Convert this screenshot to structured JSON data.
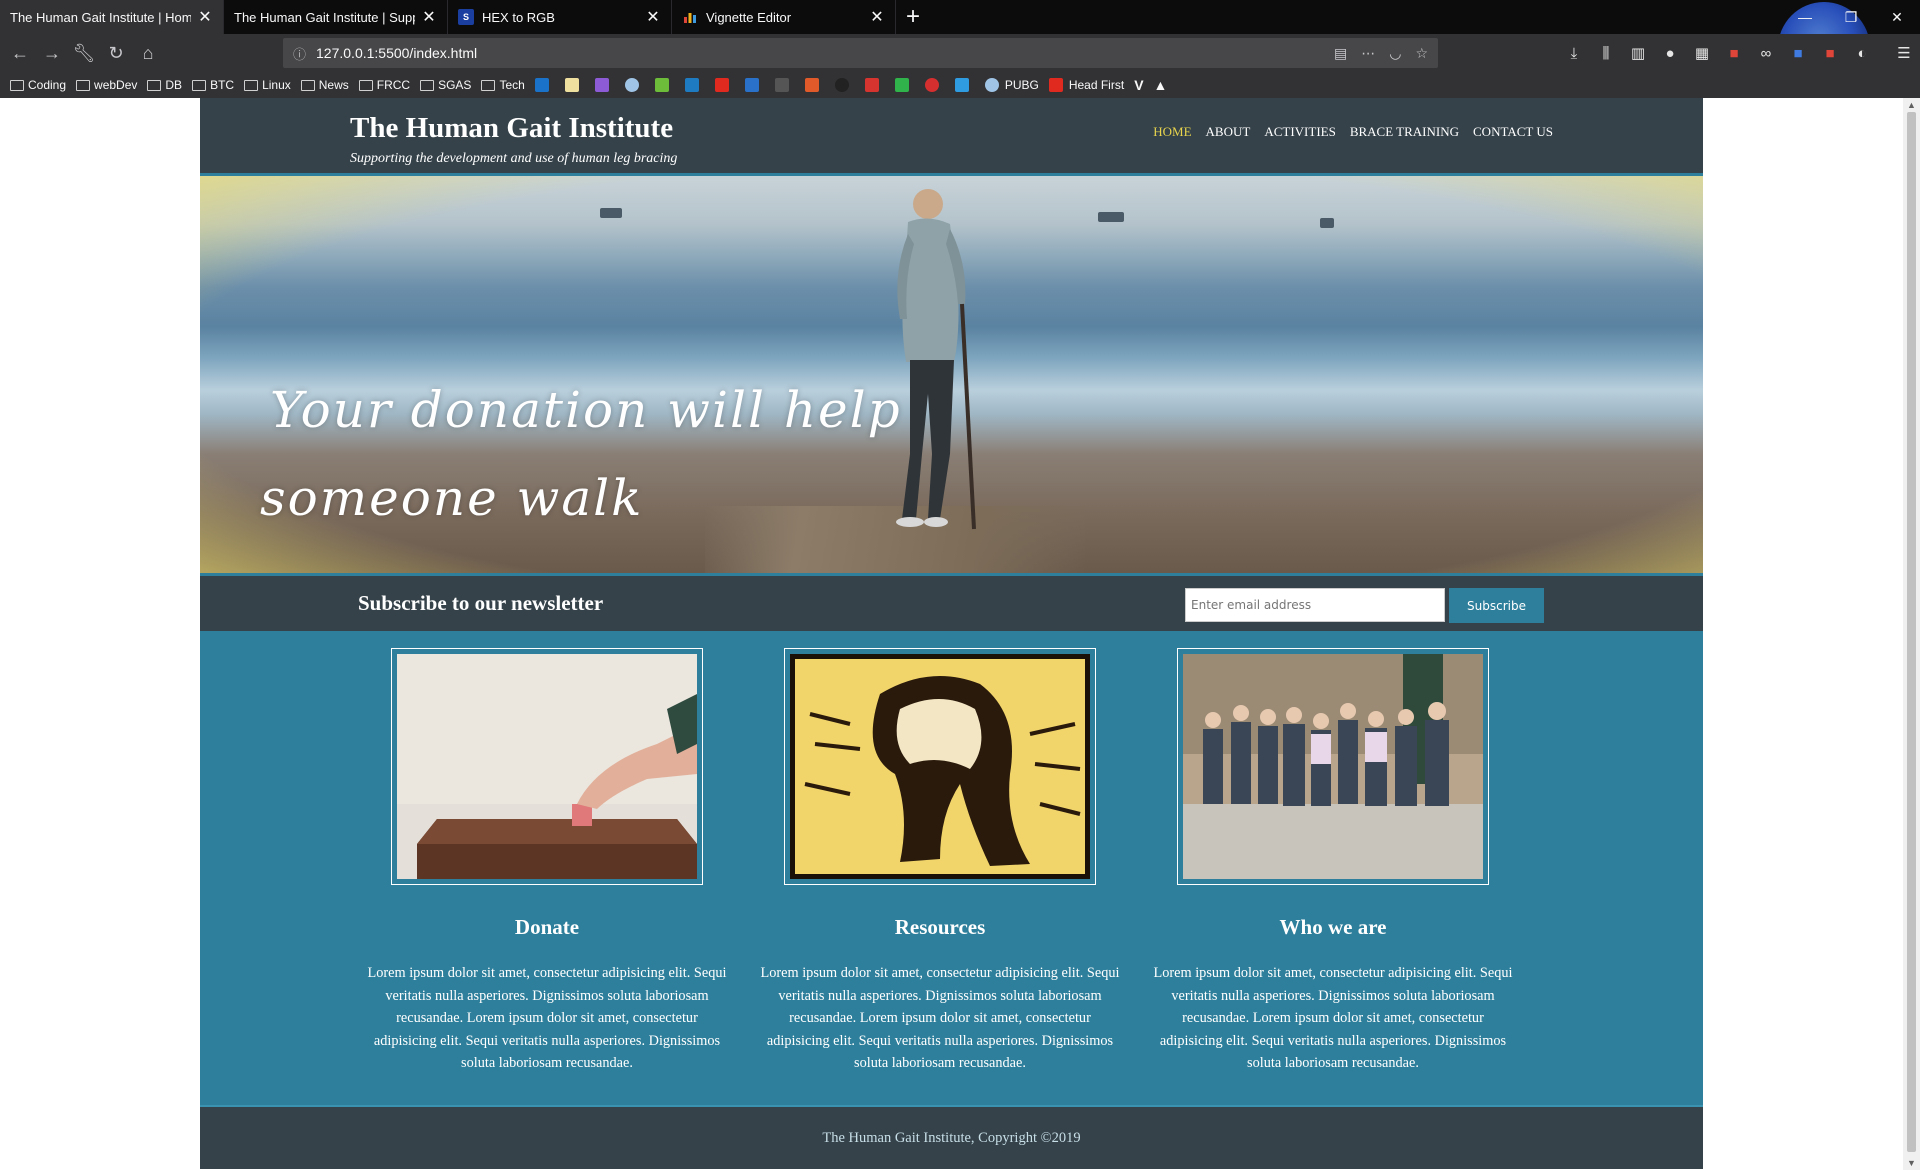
{
  "browser": {
    "tabs": [
      {
        "title": "The Human Gait Institute | Home",
        "active": true,
        "favicon": "none"
      },
      {
        "title": "The Human Gait Institute | Support",
        "active": false,
        "favicon": "none"
      },
      {
        "title": "HEX to RGB",
        "active": false,
        "favicon": "sans-tools-icon"
      },
      {
        "title": "Vignette Editor",
        "active": false,
        "favicon": "bar-chart-icon"
      }
    ],
    "url": "127.0.0.1:5500/index.html",
    "bookmarks": [
      "Coding",
      "webDev",
      "DB",
      "BTC",
      "Linux",
      "News",
      "FRCC",
      "SGAS",
      "Tech",
      "PUBG",
      "Head First"
    ]
  },
  "site": {
    "brand": {
      "title": "The Human Gait Institute",
      "subtitle": "Supporting the development and use of human leg bracing"
    },
    "nav": [
      {
        "label": "Home",
        "current": true
      },
      {
        "label": "About",
        "current": false
      },
      {
        "label": "Activities",
        "current": false
      },
      {
        "label": "Brace Training",
        "current": false
      },
      {
        "label": "Contact Us",
        "current": false
      }
    ],
    "hero": {
      "line1": "Your donation will help",
      "line2": "someone walk"
    },
    "newsletter": {
      "heading": "Subscribe to our newsletter",
      "placeholder": "Enter email address",
      "button": "Subscribe"
    },
    "boxes": [
      {
        "title": "Donate",
        "text": "Lorem ipsum dolor sit amet, consectetur adipisicing elit. Sequi veritatis nulla asperiores. Dignissimos soluta laboriosam recusandae. Lorem ipsum dolor sit amet, consectetur adipisicing elit. Sequi veritatis nulla asperiores. Dignissimos soluta laboriosam recusandae."
      },
      {
        "title": "Resources",
        "text": "Lorem ipsum dolor sit amet, consectetur adipisicing elit. Sequi veritatis nulla asperiores. Dignissimos soluta laboriosam recusandae. Lorem ipsum dolor sit amet, consectetur adipisicing elit. Sequi veritatis nulla asperiores. Dignissimos soluta laboriosam recusandae."
      },
      {
        "title": "Who we are",
        "text": "Lorem ipsum dolor sit amet, consectetur adipisicing elit. Sequi veritatis nulla asperiores. Dignissimos soluta laboriosam recusandae. Lorem ipsum dolor sit amet, consectetur adipisicing elit. Sequi veritatis nulla asperiores. Dignissimos soluta laboriosam recusandae."
      }
    ],
    "footer": "The Human Gait Institute, Copyright ©2019",
    "colors": {
      "header_bg": "#35424a",
      "accent": "#2e7f9b",
      "nav_current": "#e8d44d"
    }
  }
}
